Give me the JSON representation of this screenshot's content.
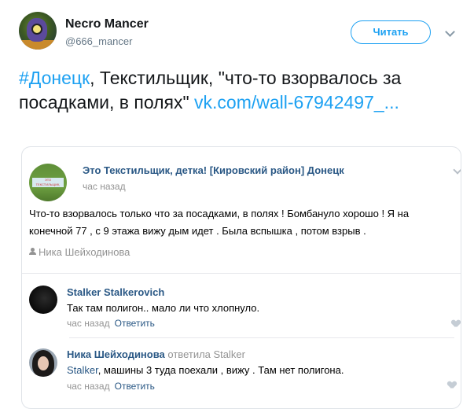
{
  "tweet": {
    "user_name": "Necro Mancer",
    "user_handle": "@666_mancer",
    "follow_label": "Читать",
    "hashtag": "#Донецк",
    "text_main": ", Текстильщик, \"что-то взорвалось за посадками, в полях\" ",
    "link": "vk.com/wall-67942497_..."
  },
  "card": {
    "group_name": "Это Текстильщик, детка! [Кировский район] Донецк",
    "avatar_caption": "ЭТО ТЕКСТИЛЬЩИК, ДЕТКА! КИРОВСКИЙ РАЙОН",
    "post_time": "час назад",
    "post_text": "Что-то взорвалось только что за посадками, в полях ! Бомбануло хорошо ! Я на конечной 77 , с 9 этажа вижу дым идет . Была вспышка , потом взрыв .",
    "author": "Ника Шейходинова",
    "comments": [
      {
        "name": "Stalker Stalkerovich",
        "reply_to": "",
        "mention": "",
        "text": "Так там полигон.. мало ли что хлопнуло.",
        "time": "час назад",
        "reply_label": "Ответить"
      },
      {
        "name": "Ника Шейходинова",
        "reply_to": "ответила Stalker",
        "mention": "Stalker",
        "text": ", машины 3 туда поехали , вижу . Там нет полигона.",
        "time": "час назад",
        "reply_label": "Ответить"
      }
    ]
  }
}
